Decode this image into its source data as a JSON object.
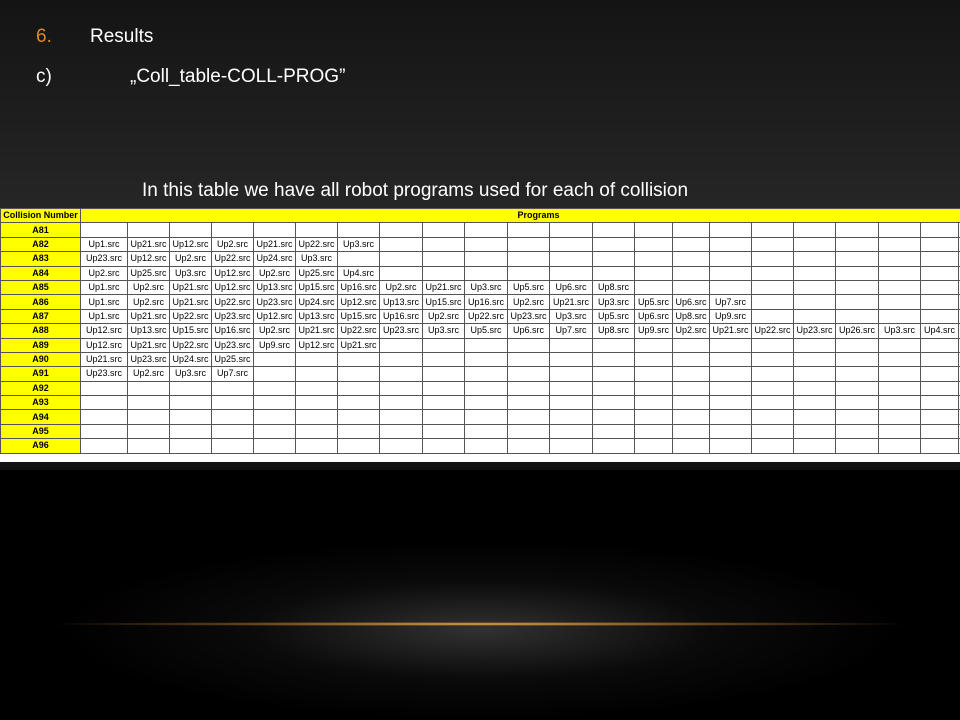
{
  "slide": {
    "section_number": "6.",
    "section_title": "Results",
    "sub_letter": "c)",
    "sub_title": "„Coll_table-COLL-PROG”",
    "description": "In this table we have all robot programs used for each of collision"
  },
  "table": {
    "header_key": "Collision Number",
    "header_programs": "Programs",
    "rows": [
      {
        "id": "A81",
        "programs": []
      },
      {
        "id": "A82",
        "programs": [
          "Up1.src",
          "Up21.src",
          "Up12.src",
          "Up2.src",
          "Up21.src",
          "Up22.src",
          "Up3.src"
        ]
      },
      {
        "id": "A83",
        "programs": [
          "Up23.src",
          "Up12.src",
          "Up2.src",
          "Up22.src",
          "Up24.src",
          "Up3.src"
        ]
      },
      {
        "id": "A84",
        "programs": [
          "Up2.src",
          "Up25.src",
          "Up3.src",
          "Up12.src",
          "Up2.src",
          "Up25.src",
          "Up4.src"
        ]
      },
      {
        "id": "A85",
        "programs": [
          "Up1.src",
          "Up2.src",
          "Up21.src",
          "Up12.src",
          "Up13.src",
          "Up15.src",
          "Up16.src",
          "Up2.src",
          "Up21.src",
          "Up3.src",
          "Up5.src",
          "Up6.src",
          "Up8.src"
        ]
      },
      {
        "id": "A86",
        "programs": [
          "Up1.src",
          "Up2.src",
          "Up21.src",
          "Up22.src",
          "Up23.src",
          "Up24.src",
          "Up12.src",
          "Up13.src",
          "Up15.src",
          "Up16.src",
          "Up2.src",
          "Up21.src",
          "Up3.src",
          "Up5.src",
          "Up6.src",
          "Up7.src"
        ]
      },
      {
        "id": "A87",
        "programs": [
          "Up1.src",
          "Up21.src",
          "Up22.src",
          "Up23.src",
          "Up12.src",
          "Up13.src",
          "Up15.src",
          "Up16.src",
          "Up2.src",
          "Up22.src",
          "Up23.src",
          "Up3.src",
          "Up5.src",
          "Up6.src",
          "Up8.src",
          "Up9.src"
        ]
      },
      {
        "id": "A88",
        "programs": [
          "Up12.src",
          "Up13.src",
          "Up15.src",
          "Up16.src",
          "Up2.src",
          "Up21.src",
          "Up22.src",
          "Up23.src",
          "Up3.src",
          "Up5.src",
          "Up6.src",
          "Up7.src",
          "Up8.src",
          "Up9.src",
          "Up2.src",
          "Up21.src",
          "Up22.src",
          "Up23.src",
          "Up26.src",
          "Up3.src",
          "Up4.src"
        ]
      },
      {
        "id": "A89",
        "programs": [
          "Up12.src",
          "Up21.src",
          "Up22.src",
          "Up23.src",
          "Up9.src",
          "Up12.src",
          "Up21.src"
        ]
      },
      {
        "id": "A90",
        "programs": [
          "Up21.src",
          "Up23.src",
          "Up24.src",
          "Up25.src"
        ]
      },
      {
        "id": "A91",
        "programs": [
          "Up23.src",
          "Up2.src",
          "Up3.src",
          "Up7.src"
        ]
      },
      {
        "id": "A92",
        "programs": []
      },
      {
        "id": "A93",
        "programs": []
      },
      {
        "id": "A94",
        "programs": []
      },
      {
        "id": "A95",
        "programs": []
      },
      {
        "id": "A96",
        "programs": []
      }
    ]
  },
  "colors": {
    "accent_number": "#d98b2b",
    "header_fill": "#ffff00"
  }
}
